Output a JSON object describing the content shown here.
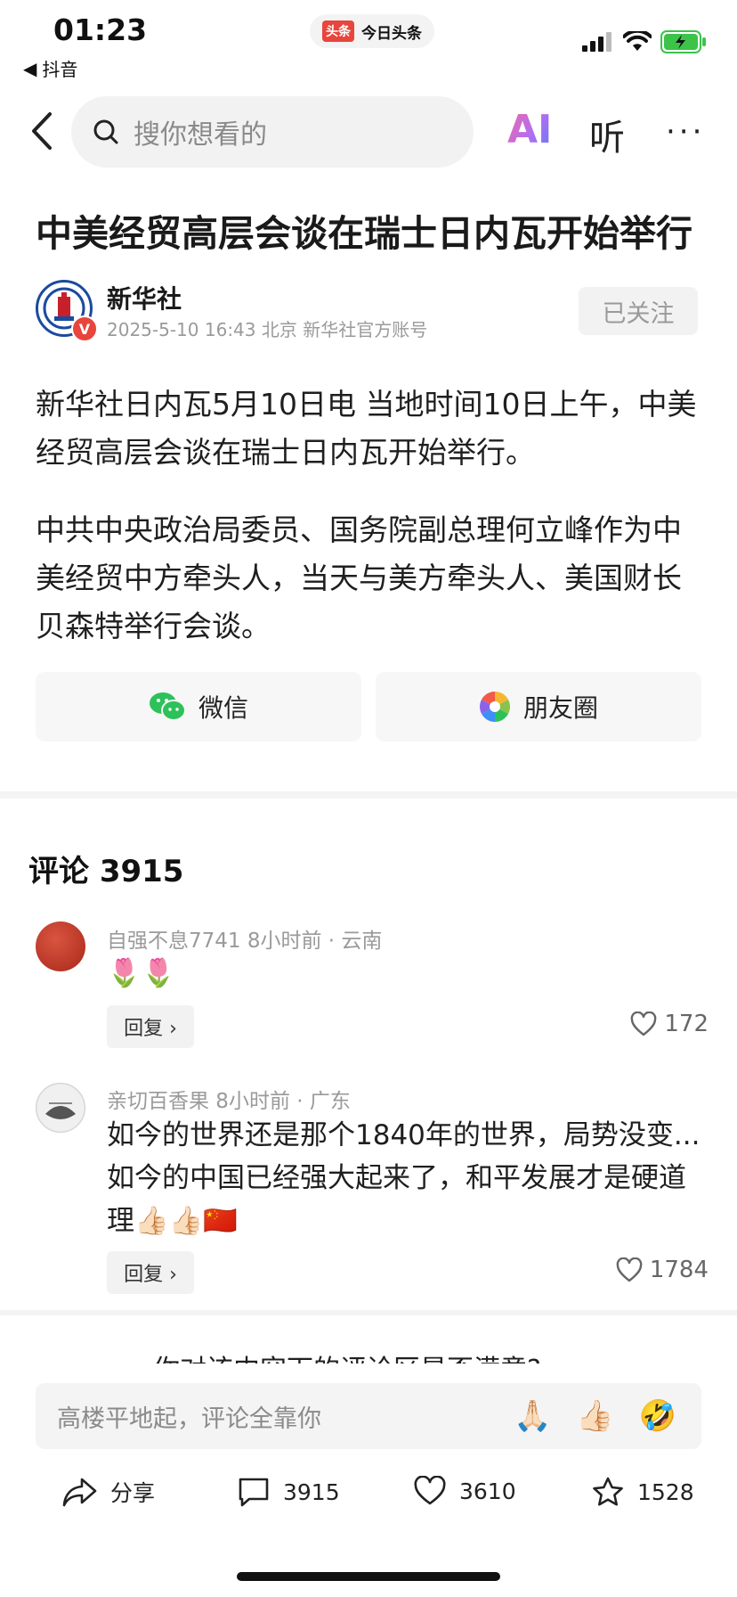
{
  "status_bar": {
    "time": "01:23",
    "app_badge_tag": "头条",
    "app_badge_name": "今日头条",
    "back_app": "抖音"
  },
  "nav": {
    "search_placeholder": "搜你想看的",
    "ai_label": "AI",
    "listen_label": "听",
    "more_label": "···"
  },
  "article": {
    "title": "中美经贸高层会谈在瑞士日内瓦开始举行",
    "author": "新华社",
    "verified_badge": "V",
    "meta": "2025-5-10  16:43  北京  新华社官方账号",
    "follow_label": "已关注",
    "paragraphs": [
      "新华社日内瓦5月10日电 当地时间10日上午，中美经贸高层会谈在瑞士日内瓦开始举行。",
      "中共中央政治局委员、国务院副总理何立峰作为中美经贸中方牵头人，当天与美方牵头人、美国财长贝森特举行会谈。"
    ],
    "share_wechat": "微信",
    "share_moments": "朋友圈"
  },
  "comments": {
    "header": "评论 3915",
    "items": [
      {
        "meta": "自强不息7741  8小时前 · 云南",
        "text": "🌷🌷",
        "reply_label": "回复 ›",
        "likes": "172"
      },
      {
        "meta": "亲切百香果  8小时前 · 广东",
        "text": "如今的世界还是那个1840年的世界，局势没变...如今的中国已经强大起来了，和平发展才是硬道理👍🏻👍🏻🇨🇳",
        "reply_label": "回复 ›",
        "likes": "1784"
      }
    ],
    "survey": "你对该内容下的评论区是否满意?"
  },
  "bottom_bar": {
    "input_placeholder": "高楼平地起，评论全靠你",
    "emojis": [
      "🙏🏻",
      "👍🏻",
      "🤣"
    ],
    "share_label": "分享",
    "comment_count": "3915",
    "like_count": "3610",
    "fav_count": "1528"
  }
}
